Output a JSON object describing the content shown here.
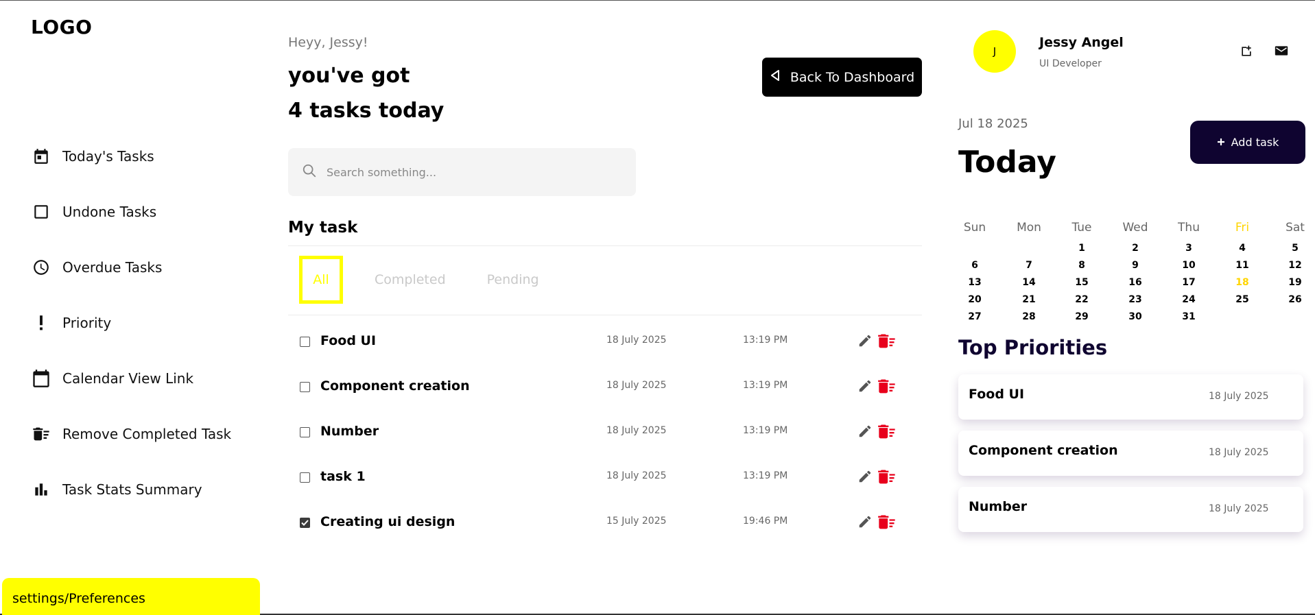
{
  "app": {
    "logo": "LOGO"
  },
  "sidebar": {
    "items": [
      {
        "label": "Today's Tasks",
        "icon": "calendar-today-icon"
      },
      {
        "label": "Undone Tasks",
        "icon": "checkbox-empty-icon"
      },
      {
        "label": "Overdue Tasks",
        "icon": "clock-icon"
      },
      {
        "label": "Priority",
        "icon": "exclamation-icon"
      },
      {
        "label": "Calendar View Link",
        "icon": "calendar-icon"
      },
      {
        "label": "Remove Completed Task",
        "icon": "delete-sweep-icon"
      },
      {
        "label": "Task Stats Summary",
        "icon": "bar-chart-icon"
      }
    ],
    "settings_label": "settings/Preferences"
  },
  "main": {
    "greeting": "Heyy, Jessy!",
    "headline_line1": "you've got",
    "headline_line2": "4 tasks today",
    "back_button": "Back To Dashboard",
    "search_placeholder": "Search something...",
    "section_title": "My task",
    "tabs": [
      {
        "label": "All",
        "active": true
      },
      {
        "label": "Completed",
        "active": false
      },
      {
        "label": "Pending",
        "active": false
      }
    ],
    "tasks": [
      {
        "title": "Food UI",
        "date": "18 July 2025",
        "time": "13:19 PM",
        "checked": false
      },
      {
        "title": "Component creation",
        "date": "18 July 2025",
        "time": "13:19 PM",
        "checked": false
      },
      {
        "title": "Number",
        "date": "18 July 2025",
        "time": "13:19 PM",
        "checked": false
      },
      {
        "title": "task 1",
        "date": "18 July 2025",
        "time": "13:19 PM",
        "checked": false
      },
      {
        "title": "Creating ui design",
        "date": "15 July 2025",
        "time": "19:46 PM",
        "checked": true
      }
    ]
  },
  "profile": {
    "initial": "J",
    "name": "Jessy Angel",
    "role": "UI Developer"
  },
  "right": {
    "current_date": "Jul 18 2025",
    "today_title": "Today",
    "add_task_label": "Add task",
    "calendar": {
      "weekdays": [
        "Sun",
        "Mon",
        "Tue",
        "Wed",
        "Thu",
        "Fri",
        "Sat"
      ],
      "highlight_weekday": "Fri",
      "weeks": [
        [
          "",
          "",
          "1",
          "2",
          "3",
          "4",
          "5"
        ],
        [
          "6",
          "7",
          "8",
          "9",
          "10",
          "11",
          "12"
        ],
        [
          "13",
          "14",
          "15",
          "16",
          "17",
          "18",
          "19"
        ],
        [
          "20",
          "21",
          "22",
          "23",
          "24",
          "25",
          "26"
        ],
        [
          "27",
          "28",
          "29",
          "30",
          "31",
          "",
          ""
        ]
      ],
      "highlight_day": "18"
    },
    "priorities_title": "Top Priorities",
    "priorities": [
      {
        "name": "Food UI",
        "date": "18 July 2025"
      },
      {
        "name": "Component creation",
        "date": "18 July 2025"
      },
      {
        "name": "Number",
        "date": "18 July 2025"
      }
    ]
  },
  "colors": {
    "accent_yellow": "#ffff00",
    "calendar_highlight": "#ffd500",
    "navy": "#0f0430",
    "delete_red": "#e8001c"
  }
}
